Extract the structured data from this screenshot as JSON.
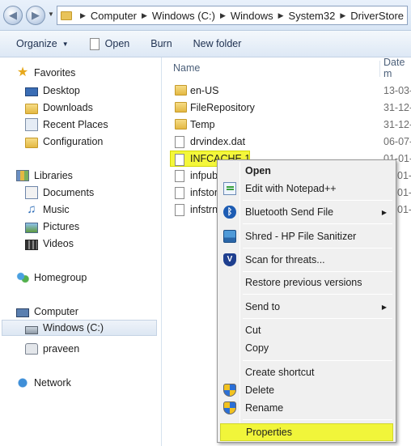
{
  "address": {
    "breadcrumbs": [
      "Computer",
      "Windows (C:)",
      "Windows",
      "System32",
      "DriverStore"
    ]
  },
  "toolbar": {
    "organize_label": "Organize",
    "open_label": "Open",
    "burn_label": "Burn",
    "new_folder_label": "New folder"
  },
  "nav": {
    "favorites": "Favorites",
    "desktop": "Desktop",
    "downloads": "Downloads",
    "recent_places": "Recent Places",
    "configuration": "Configuration",
    "libraries": "Libraries",
    "documents": "Documents",
    "music": "Music",
    "pictures": "Pictures",
    "videos": "Videos",
    "homegroup": "Homegroup",
    "computer": "Computer",
    "windows_c": "Windows (C:)",
    "praveen": "praveen",
    "network": "Network"
  },
  "columns": {
    "name": "Name",
    "date": "Date m"
  },
  "files": [
    {
      "name": "en-US",
      "date": "13-03-",
      "type": "folder"
    },
    {
      "name": "FileRepository",
      "date": "31-12-",
      "type": "folder"
    },
    {
      "name": "Temp",
      "date": "31-12-",
      "type": "folder"
    },
    {
      "name": "drvindex.dat",
      "date": "06-07-",
      "type": "file"
    },
    {
      "name": "INFCACHE.1",
      "date": "01-01-",
      "type": "file"
    },
    {
      "name": "infpub",
      "date": "01-",
      "type": "file"
    },
    {
      "name": "infstor",
      "date": "01-",
      "type": "file"
    },
    {
      "name": "infstrn",
      "date": "01-",
      "type": "file"
    }
  ],
  "context_menu": {
    "open": "Open",
    "edit_notepad": "Edit with Notepad++",
    "bluetooth": "Bluetooth Send File",
    "shred": "Shred - HP File Sanitizer",
    "scan": "Scan for threats...",
    "restore": "Restore previous versions",
    "send_to": "Send to",
    "cut": "Cut",
    "copy": "Copy",
    "create_shortcut": "Create shortcut",
    "delete": "Delete",
    "rename": "Rename",
    "properties": "Properties"
  },
  "colors": {
    "highlight": "#f4f73a",
    "chrome": "#dde8f5",
    "menu_bg": "#f0f0f0"
  }
}
